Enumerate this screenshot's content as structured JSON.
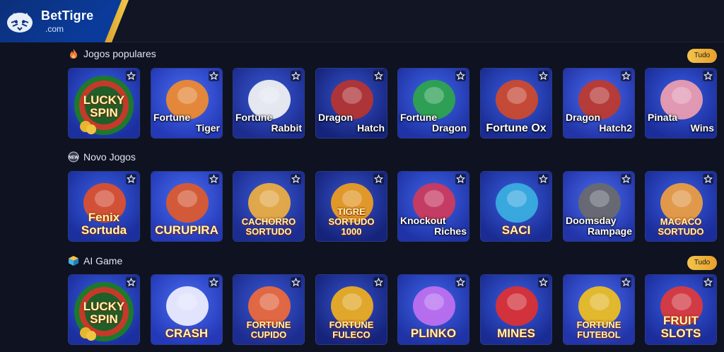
{
  "brand": {
    "name": "BetTigre",
    "sub": ".com"
  },
  "colors": {
    "accent": "#f3c44d",
    "card_bg": "#2a46c9",
    "page_bg": "#0f1220"
  },
  "sections": [
    {
      "title": "Jogos populares",
      "icon": "fire-icon",
      "more_label": "Tudo",
      "games": [
        {
          "line1": "LUCKY",
          "line2": "SPIN",
          "style": "lucky"
        },
        {
          "line1": "Fortune",
          "line2": "Tiger",
          "style": "two"
        },
        {
          "line1": "Fortune",
          "line2": "Rabbit",
          "style": "two"
        },
        {
          "line1": "Dragon",
          "line2": "Hatch",
          "style": "two"
        },
        {
          "line1": "Fortune",
          "line2": "Dragon",
          "style": "two"
        },
        {
          "line1": "Fortune Ox",
          "line2": "",
          "style": "one"
        },
        {
          "line1": "Dragon",
          "line2": "Hatch2",
          "style": "two"
        },
        {
          "line1": "Pinata",
          "line2": "Wins",
          "style": "two"
        }
      ]
    },
    {
      "title": "Novo Jogos",
      "icon": "new-icon",
      "more_label": "",
      "games": [
        {
          "line1": "Fenix",
          "line2": "Sortuda",
          "style": "big"
        },
        {
          "line1": "CURUPIRA",
          "line2": "",
          "style": "big"
        },
        {
          "line1": "CACHORRO",
          "line2": "SORTUDO",
          "style": "big"
        },
        {
          "line1": "TIGRE SORTUDO",
          "line2": "1000",
          "style": "big"
        },
        {
          "line1": "Knockout",
          "line2": "Riches",
          "style": "two"
        },
        {
          "line1": "SACI",
          "line2": "",
          "style": "big"
        },
        {
          "line1": "Doomsday",
          "line2": "Rampage",
          "style": "two"
        },
        {
          "line1": "MACACO",
          "line2": "SORTUDO",
          "style": "big"
        }
      ]
    },
    {
      "title": "AI Game",
      "icon": "cube-icon",
      "more_label": "Tudo",
      "games": [
        {
          "line1": "LUCKY",
          "line2": "SPIN",
          "style": "lucky"
        },
        {
          "line1": "CRASH",
          "line2": "",
          "style": "big"
        },
        {
          "line1": "FORTUNE",
          "line2": "CUPIDO",
          "style": "big"
        },
        {
          "line1": "FORTUNE",
          "line2": "FULECO",
          "style": "big"
        },
        {
          "line1": "PLINKO",
          "line2": "",
          "style": "big"
        },
        {
          "line1": "MINES",
          "line2": "",
          "style": "big"
        },
        {
          "line1": "FORTUNE",
          "line2": "FUTEBOL",
          "style": "big"
        },
        {
          "line1": "FRUIT",
          "line2": "SLOTS",
          "style": "big"
        }
      ]
    }
  ]
}
